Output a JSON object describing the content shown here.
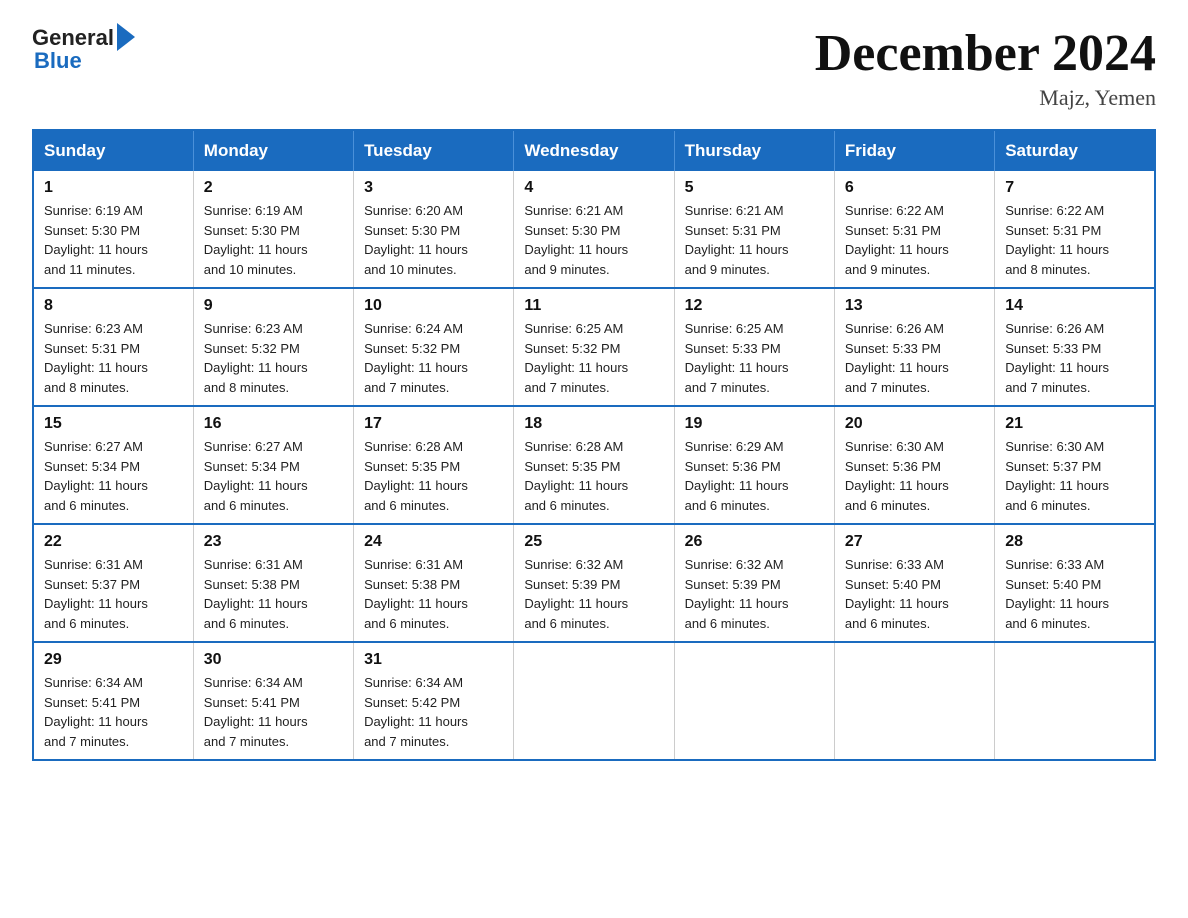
{
  "header": {
    "logo_general": "General",
    "logo_blue": "Blue",
    "month_title": "December 2024",
    "location": "Majz, Yemen"
  },
  "days_of_week": [
    "Sunday",
    "Monday",
    "Tuesday",
    "Wednesday",
    "Thursday",
    "Friday",
    "Saturday"
  ],
  "weeks": [
    [
      {
        "day": "1",
        "sunrise": "6:19 AM",
        "sunset": "5:30 PM",
        "daylight": "11 hours and 11 minutes."
      },
      {
        "day": "2",
        "sunrise": "6:19 AM",
        "sunset": "5:30 PM",
        "daylight": "11 hours and 10 minutes."
      },
      {
        "day": "3",
        "sunrise": "6:20 AM",
        "sunset": "5:30 PM",
        "daylight": "11 hours and 10 minutes."
      },
      {
        "day": "4",
        "sunrise": "6:21 AM",
        "sunset": "5:30 PM",
        "daylight": "11 hours and 9 minutes."
      },
      {
        "day": "5",
        "sunrise": "6:21 AM",
        "sunset": "5:31 PM",
        "daylight": "11 hours and 9 minutes."
      },
      {
        "day": "6",
        "sunrise": "6:22 AM",
        "sunset": "5:31 PM",
        "daylight": "11 hours and 9 minutes."
      },
      {
        "day": "7",
        "sunrise": "6:22 AM",
        "sunset": "5:31 PM",
        "daylight": "11 hours and 8 minutes."
      }
    ],
    [
      {
        "day": "8",
        "sunrise": "6:23 AM",
        "sunset": "5:31 PM",
        "daylight": "11 hours and 8 minutes."
      },
      {
        "day": "9",
        "sunrise": "6:23 AM",
        "sunset": "5:32 PM",
        "daylight": "11 hours and 8 minutes."
      },
      {
        "day": "10",
        "sunrise": "6:24 AM",
        "sunset": "5:32 PM",
        "daylight": "11 hours and 7 minutes."
      },
      {
        "day": "11",
        "sunrise": "6:25 AM",
        "sunset": "5:32 PM",
        "daylight": "11 hours and 7 minutes."
      },
      {
        "day": "12",
        "sunrise": "6:25 AM",
        "sunset": "5:33 PM",
        "daylight": "11 hours and 7 minutes."
      },
      {
        "day": "13",
        "sunrise": "6:26 AM",
        "sunset": "5:33 PM",
        "daylight": "11 hours and 7 minutes."
      },
      {
        "day": "14",
        "sunrise": "6:26 AM",
        "sunset": "5:33 PM",
        "daylight": "11 hours and 7 minutes."
      }
    ],
    [
      {
        "day": "15",
        "sunrise": "6:27 AM",
        "sunset": "5:34 PM",
        "daylight": "11 hours and 6 minutes."
      },
      {
        "day": "16",
        "sunrise": "6:27 AM",
        "sunset": "5:34 PM",
        "daylight": "11 hours and 6 minutes."
      },
      {
        "day": "17",
        "sunrise": "6:28 AM",
        "sunset": "5:35 PM",
        "daylight": "11 hours and 6 minutes."
      },
      {
        "day": "18",
        "sunrise": "6:28 AM",
        "sunset": "5:35 PM",
        "daylight": "11 hours and 6 minutes."
      },
      {
        "day": "19",
        "sunrise": "6:29 AM",
        "sunset": "5:36 PM",
        "daylight": "11 hours and 6 minutes."
      },
      {
        "day": "20",
        "sunrise": "6:30 AM",
        "sunset": "5:36 PM",
        "daylight": "11 hours and 6 minutes."
      },
      {
        "day": "21",
        "sunrise": "6:30 AM",
        "sunset": "5:37 PM",
        "daylight": "11 hours and 6 minutes."
      }
    ],
    [
      {
        "day": "22",
        "sunrise": "6:31 AM",
        "sunset": "5:37 PM",
        "daylight": "11 hours and 6 minutes."
      },
      {
        "day": "23",
        "sunrise": "6:31 AM",
        "sunset": "5:38 PM",
        "daylight": "11 hours and 6 minutes."
      },
      {
        "day": "24",
        "sunrise": "6:31 AM",
        "sunset": "5:38 PM",
        "daylight": "11 hours and 6 minutes."
      },
      {
        "day": "25",
        "sunrise": "6:32 AM",
        "sunset": "5:39 PM",
        "daylight": "11 hours and 6 minutes."
      },
      {
        "day": "26",
        "sunrise": "6:32 AM",
        "sunset": "5:39 PM",
        "daylight": "11 hours and 6 minutes."
      },
      {
        "day": "27",
        "sunrise": "6:33 AM",
        "sunset": "5:40 PM",
        "daylight": "11 hours and 6 minutes."
      },
      {
        "day": "28",
        "sunrise": "6:33 AM",
        "sunset": "5:40 PM",
        "daylight": "11 hours and 6 minutes."
      }
    ],
    [
      {
        "day": "29",
        "sunrise": "6:34 AM",
        "sunset": "5:41 PM",
        "daylight": "11 hours and 7 minutes."
      },
      {
        "day": "30",
        "sunrise": "6:34 AM",
        "sunset": "5:41 PM",
        "daylight": "11 hours and 7 minutes."
      },
      {
        "day": "31",
        "sunrise": "6:34 AM",
        "sunset": "5:42 PM",
        "daylight": "11 hours and 7 minutes."
      },
      null,
      null,
      null,
      null
    ]
  ],
  "sunrise_label": "Sunrise:",
  "sunset_label": "Sunset:",
  "daylight_label": "Daylight:"
}
